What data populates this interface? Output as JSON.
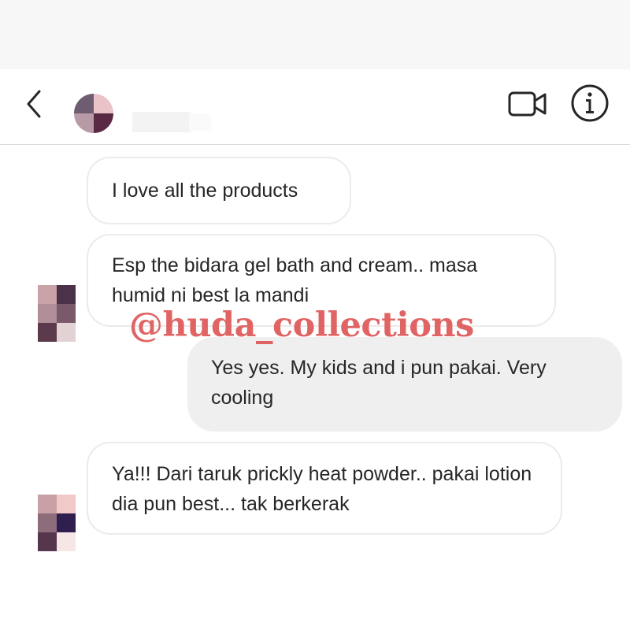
{
  "header": {
    "back_icon": "chevron-left-icon",
    "video_icon": "video-camera-icon",
    "info_icon": "info-icon"
  },
  "messages": [
    {
      "direction": "incoming",
      "text": "I love all the products"
    },
    {
      "direction": "incoming",
      "text": "Esp the bidara gel bath and cream.. masa humid ni best la mandi"
    },
    {
      "direction": "outgoing",
      "text": "Yes yes. My kids and i pun pakai. Very cooling"
    },
    {
      "direction": "incoming",
      "text": "Ya!!! Dari taruk prickly heat powder.. pakai lotion dia pun best... tak berkerak"
    }
  ],
  "watermark": "@huda_collections",
  "colors": {
    "incoming_bubble_border": "#ebebeb",
    "outgoing_bubble_bg": "#efefef",
    "watermark": "#e06464",
    "header_border": "#dbdbdb"
  }
}
